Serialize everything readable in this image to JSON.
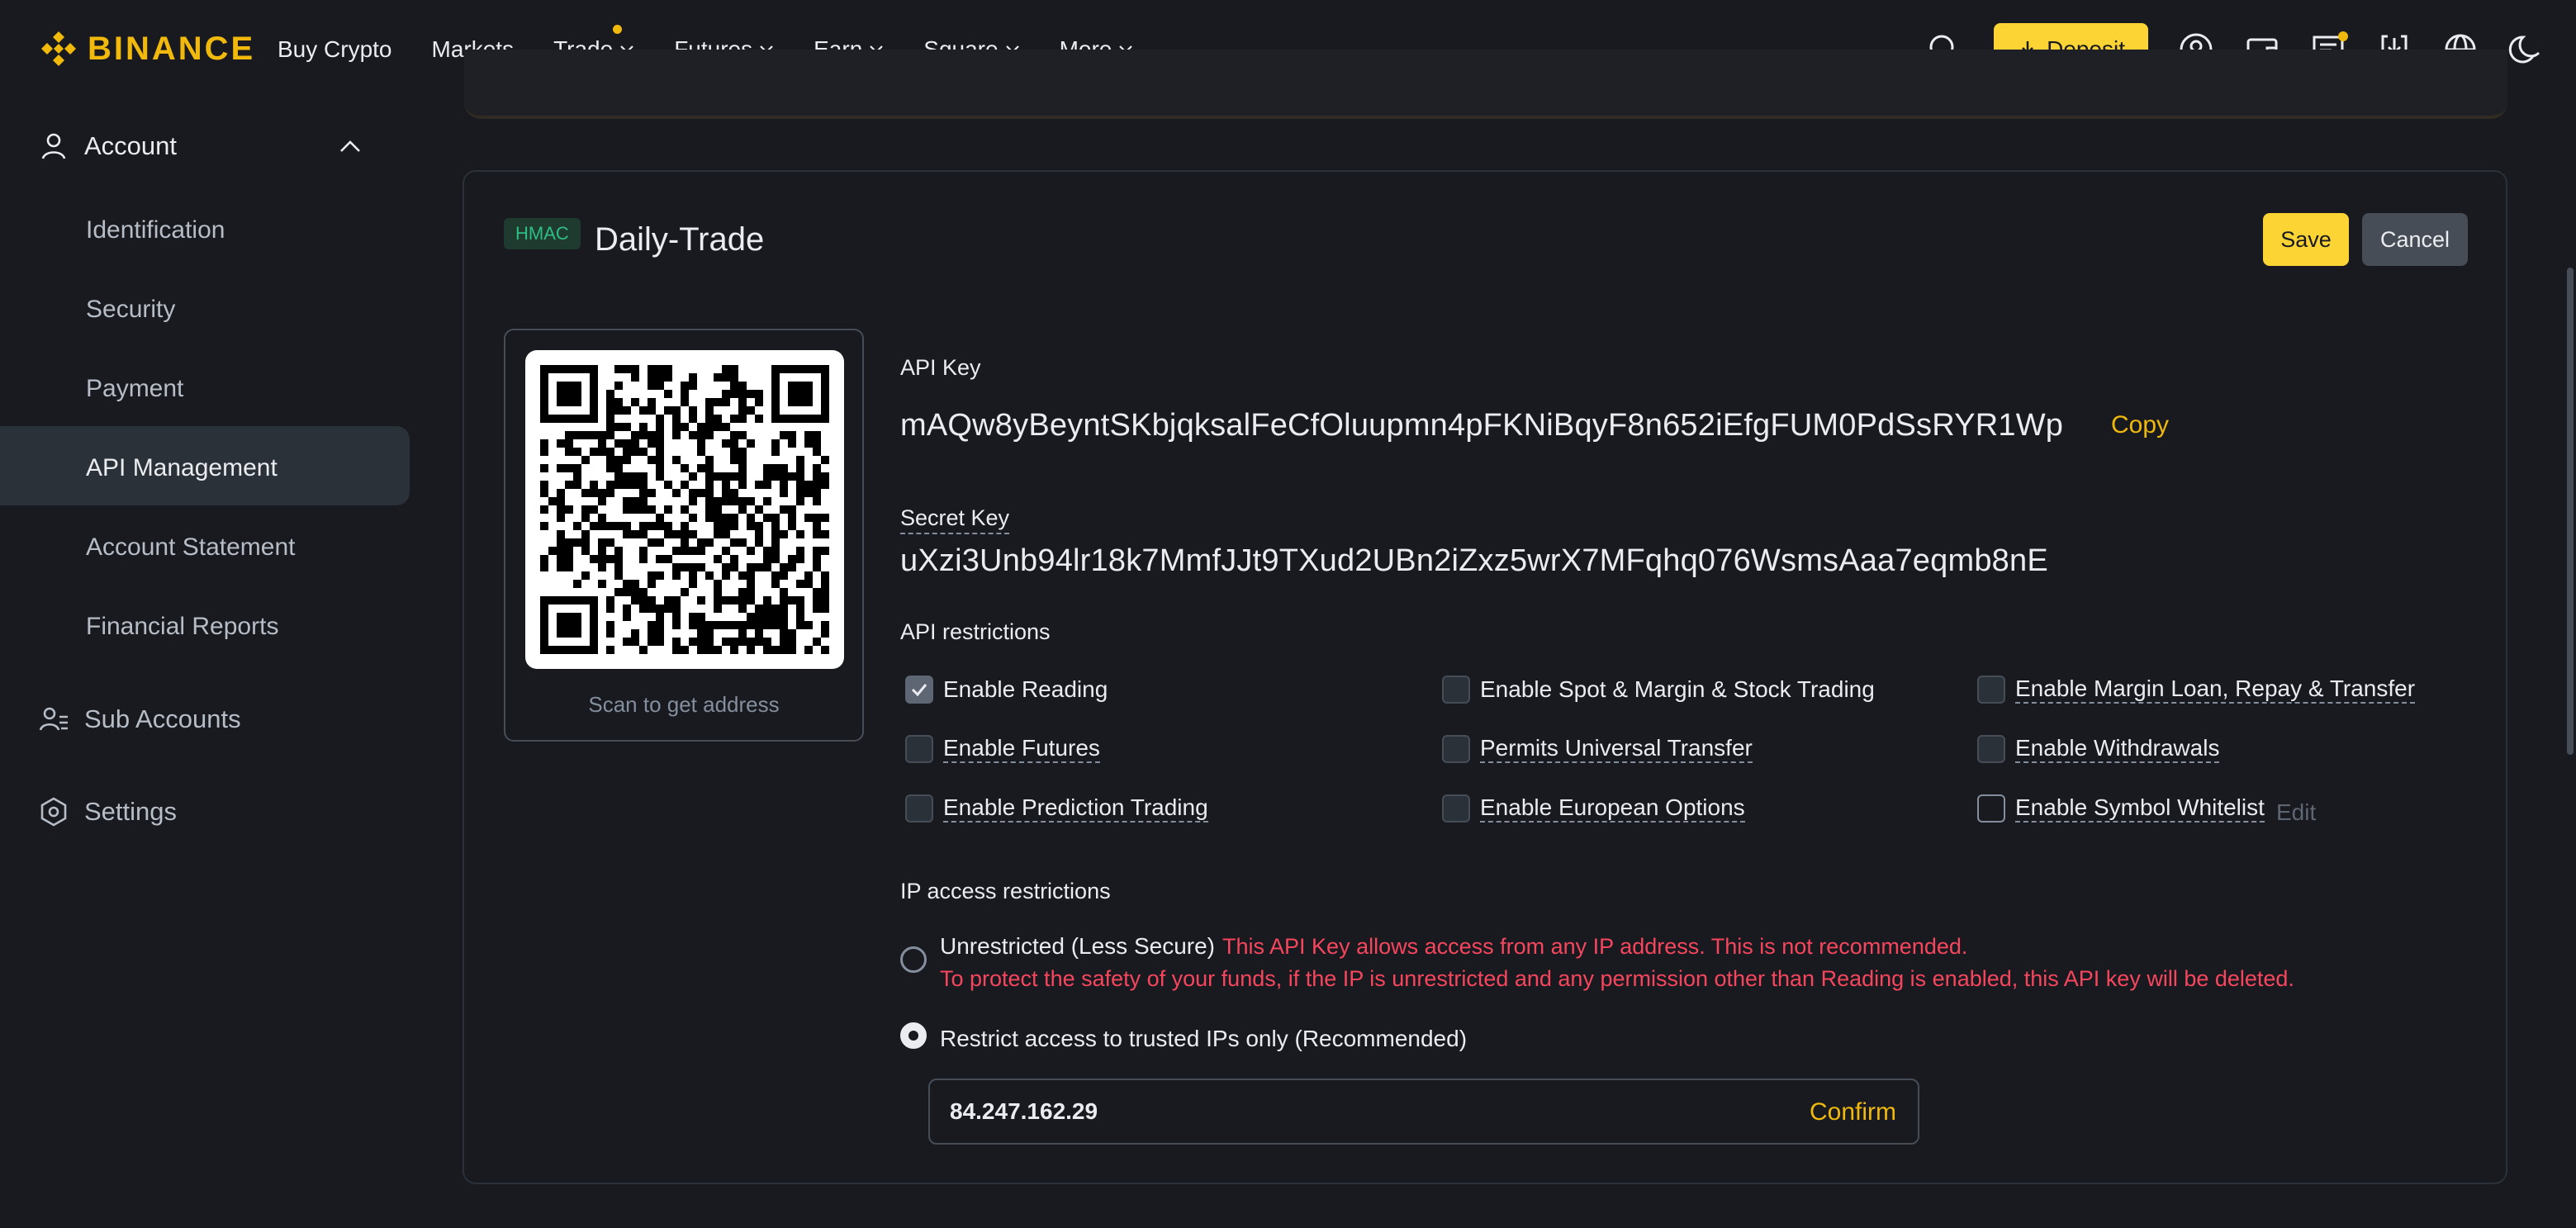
{
  "brand": {
    "name": "BINANCE",
    "color": "#f0b90b"
  },
  "nav": {
    "items": [
      {
        "label": "Buy Crypto",
        "dropdown": false
      },
      {
        "label": "Markets",
        "dropdown": false
      },
      {
        "label": "Trade",
        "dropdown": true,
        "badge": true
      },
      {
        "label": "Futures",
        "dropdown": true
      },
      {
        "label": "Earn",
        "dropdown": true
      },
      {
        "label": "Square",
        "dropdown": true
      },
      {
        "label": "More",
        "dropdown": true
      }
    ],
    "deposit_label": "Deposit"
  },
  "sidebar": {
    "account_label": "Account",
    "items": [
      "Identification",
      "Security",
      "Payment",
      "API Management",
      "Account Statement",
      "Financial Reports"
    ],
    "active": "API Management",
    "sub_accounts_label": "Sub Accounts",
    "settings_label": "Settings"
  },
  "api_card": {
    "type_badge": "HMAC",
    "name": "Daily-Trade",
    "save_label": "Save",
    "cancel_label": "Cancel",
    "qr_caption": "Scan to get address",
    "api_key_label": "API Key",
    "api_key": "mAQw8yBeyntSKbjqksalFeCfOluupmn4pFKNiBqyF8n652iEfgFUM0PdSsRYR1Wp",
    "copy_label": "Copy",
    "secret_key_label": "Secret Key",
    "secret_key": "uXzi3Unb94lr18k7MmfJJt9TXud2UBn2iZxz5wrX7MFqhq076WsmsAaa7eqmb8nE",
    "restrictions_label": "API restrictions",
    "permissions": [
      {
        "label": "Enable Reading",
        "checked": true
      },
      {
        "label": "Enable Spot & Margin & Stock Trading",
        "checked": false
      },
      {
        "label": "Enable Margin Loan, Repay & Transfer",
        "checked": false
      },
      {
        "label": "Enable Futures",
        "checked": false
      },
      {
        "label": "Permits Universal Transfer",
        "checked": false
      },
      {
        "label": "Enable Withdrawals",
        "checked": false
      },
      {
        "label": "Enable Prediction Trading",
        "checked": false
      },
      {
        "label": "Enable European Options",
        "checked": false
      },
      {
        "label": "Enable Symbol Whitelist",
        "checked": false
      }
    ],
    "whitelist_edit_label": "Edit",
    "ip_section_label": "IP access restrictions",
    "ip_options": {
      "unrestricted_label": "Unrestricted (Less Secure)",
      "unrestricted_warning_1": "This API Key allows access from any IP address. This is not recommended.",
      "unrestricted_warning_2": "To protect the safety of your funds, if the IP is unrestricted and any permission other than Reading is enabled, this API key will be deleted.",
      "restricted_label": "Restrict access to trusted IPs only (Recommended)",
      "selected": "restricted"
    },
    "ip_value": "84.247.162.29",
    "confirm_label": "Confirm"
  }
}
